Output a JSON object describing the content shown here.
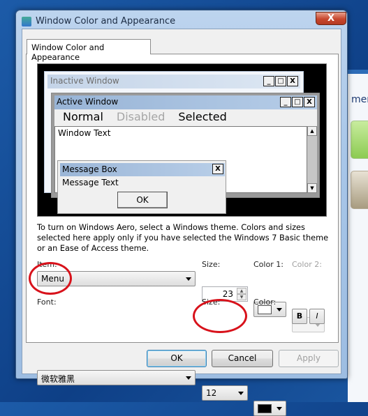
{
  "background": {
    "partial_text": "mer"
  },
  "dialog": {
    "title": "Window Color and Appearance",
    "close_label": "X",
    "tab": "Window Color and Appearance",
    "preview": {
      "inactive_title": "Inactive Window",
      "active_title": "Active Window",
      "menu_normal": "Normal",
      "menu_disabled": "Disabled",
      "menu_selected": "Selected",
      "window_text": "Window Text",
      "msgbox_title": "Message Box",
      "msgbox_text": "Message Text",
      "msgbox_ok": "OK",
      "min": "_",
      "max": "□",
      "close": "X"
    },
    "info_text": "To turn on Windows Aero, select a Windows theme.  Colors and sizes selected here apply only if you have selected the Windows 7 Basic theme or an Ease of Access theme.",
    "item": {
      "label": "Item:",
      "value": "Menu"
    },
    "item_size": {
      "label": "Size:",
      "value": "23"
    },
    "color1": {
      "label": "Color 1:",
      "value": "#ffffff"
    },
    "color2": {
      "label": "Color 2:"
    },
    "font": {
      "label": "Font:",
      "value": "微软雅黑"
    },
    "font_size": {
      "label": "Size:",
      "value": "12"
    },
    "font_color": {
      "label": "Color:",
      "value": "#000000"
    },
    "bold_label": "B",
    "italic_label": "I",
    "buttons": {
      "ok": "OK",
      "cancel": "Cancel",
      "apply": "Apply"
    },
    "annotation_color": "#d8121b"
  }
}
